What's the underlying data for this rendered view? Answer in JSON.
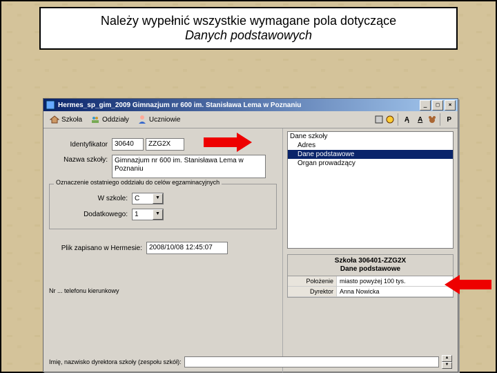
{
  "callout": {
    "line1": "Należy wypełnić wszystkie wymagane pola dotyczące",
    "line2": "Danych podstawowych"
  },
  "window": {
    "title": "Hermes_sp_gim_2009   Gimnazjum nr 600 im. Stanisława Lema w Poznaniu",
    "buttons": {
      "min": "_",
      "max": "□",
      "close": "×"
    }
  },
  "toolbar": {
    "tab_szkola": "Szkoła",
    "tab_oddzialy": "Oddziały",
    "tab_uczniowie": "Uczniowie",
    "a_label": "Ą",
    "aa_label": "A",
    "bear_label": "",
    "p_label": "P"
  },
  "form": {
    "ident_label": "Identyfikator",
    "ident_v1": "30640",
    "ident_v2": "ZZG2X",
    "nazwa_label": "Nazwa szkoły:",
    "nazwa_value": "Gimnazjum nr 600 im. Stanisława Lema w\nPoznaniu",
    "group_legend": "Oznaczenie ostatniego oddziału do celów egzaminacyjnych",
    "wszkole_label": "W szkole:",
    "wszkole_val": "C",
    "dodatk_label": "Dodatkowego:",
    "dodatk_val": "1",
    "plik_label": "Plik zapisano w Hermesie:",
    "plik_val": "2008/10/08 12:45:07",
    "bottom_label1": "Nr   ... telefonu  kierunkowy",
    "bottom_label2": "Imię, nazwisko dyrektora szkoły (zespołu szkół):"
  },
  "tree": {
    "root": "Dane szkoły",
    "n1": "Adres",
    "n2": "Dane podstawowe",
    "n3": "Organ prowadzący"
  },
  "detail": {
    "head1": "Szkoła 306401-ZZG2X",
    "head2": "Dane podstawowe",
    "r1l": "Położenie",
    "r1v": "miasto powyżej 100 tys.",
    "r2l": "Dyrektor",
    "r2v": "Anna Nowicka"
  }
}
